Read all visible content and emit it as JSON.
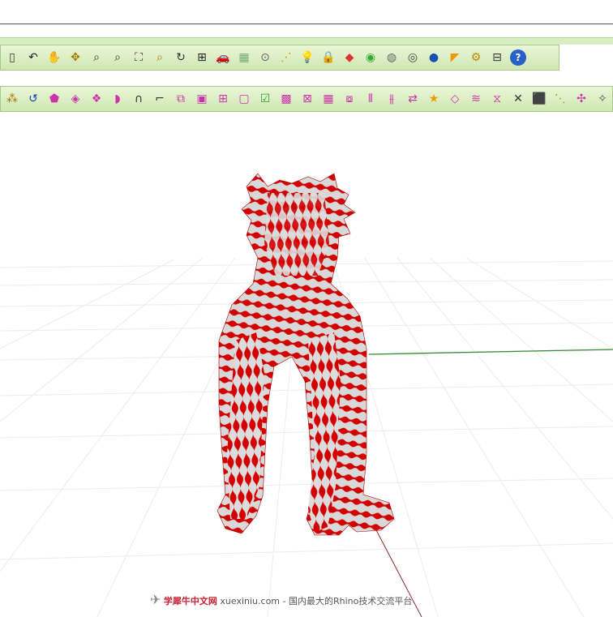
{
  "toolbar_main": {
    "buttons": [
      {
        "name": "new-file-icon",
        "glyph": "▯",
        "color": "#333"
      },
      {
        "name": "undo-icon",
        "glyph": "↶",
        "color": "#222"
      },
      {
        "name": "pan-hand-icon",
        "glyph": "✋",
        "color": "#333"
      },
      {
        "name": "rotate-view-icon",
        "glyph": "✥",
        "color": "#a57a00"
      },
      {
        "name": "zoom-icon",
        "glyph": "⌕",
        "color": "#333"
      },
      {
        "name": "zoom-window-icon",
        "glyph": "⌕",
        "color": "#333"
      },
      {
        "name": "zoom-extents-icon",
        "glyph": "⛶",
        "color": "#333"
      },
      {
        "name": "zoom-selected-icon",
        "glyph": "⌕",
        "color": "#a57a00"
      },
      {
        "name": "undo-view-icon",
        "glyph": "↻",
        "color": "#333"
      },
      {
        "name": "four-viewports-icon",
        "glyph": "⊞",
        "color": "#222"
      },
      {
        "name": "car-icon",
        "glyph": "🚗",
        "color": "#c00"
      },
      {
        "name": "grid-icon",
        "glyph": "▦",
        "color": "#7a7"
      },
      {
        "name": "cplane-icon",
        "glyph": "⊙",
        "color": "#666"
      },
      {
        "name": "select-points-icon",
        "glyph": "⋰",
        "color": "#c90"
      },
      {
        "name": "light-bulb-icon",
        "glyph": "💡",
        "color": "#999"
      },
      {
        "name": "lock-icon",
        "glyph": "🔒",
        "color": "#555"
      },
      {
        "name": "layer-color-icon",
        "glyph": "◆",
        "color": "#d33"
      },
      {
        "name": "color-wheel-icon",
        "glyph": "◉",
        "color": "#3a3"
      },
      {
        "name": "sphere-wire-icon",
        "glyph": "◍",
        "color": "#666"
      },
      {
        "name": "render-sphere-icon",
        "glyph": "◎",
        "color": "#444"
      },
      {
        "name": "blue-sphere-icon",
        "glyph": "●",
        "color": "#1a4fb0"
      },
      {
        "name": "flag-icon",
        "glyph": "◤",
        "color": "#e90"
      },
      {
        "name": "settings-gear-icon",
        "glyph": "⚙",
        "color": "#b80"
      },
      {
        "name": "grouping-icon",
        "glyph": "⊟",
        "color": "#333"
      },
      {
        "name": "help-icon",
        "glyph": "?",
        "color": "#fff",
        "bg": "#2860c8"
      }
    ]
  },
  "toolbar_surface": {
    "buttons": [
      {
        "name": "surface-points-icon",
        "glyph": "⁂",
        "color": "#a70"
      },
      {
        "name": "rebuild-icon",
        "glyph": "↺",
        "color": "#14a"
      },
      {
        "name": "polygon-surface-icon",
        "glyph": "⬟",
        "color": "#c3a"
      },
      {
        "name": "patch-icon",
        "glyph": "◈",
        "color": "#c3a"
      },
      {
        "name": "loft-icon",
        "glyph": "❖",
        "color": "#c3a"
      },
      {
        "name": "sweep-icon",
        "glyph": "◗",
        "color": "#c3a"
      },
      {
        "name": "revolve-icon",
        "glyph": "∩",
        "color": "#333"
      },
      {
        "name": "blend-edge-icon",
        "glyph": "⌐",
        "color": "#333"
      },
      {
        "name": "extrude-icon",
        "glyph": "⧉",
        "color": "#c3a"
      },
      {
        "name": "box-icon",
        "glyph": "▣",
        "color": "#c3a"
      },
      {
        "name": "network-surface-icon",
        "glyph": "⊞",
        "color": "#c3a"
      },
      {
        "name": "frame-icon",
        "glyph": "▢",
        "color": "#c3a"
      },
      {
        "name": "check-surface-icon",
        "glyph": "☑",
        "color": "#393"
      },
      {
        "name": "mesh-icon",
        "glyph": "▩",
        "color": "#c3a"
      },
      {
        "name": "delete-mesh-icon",
        "glyph": "⊠",
        "color": "#c3a"
      },
      {
        "name": "pink-grid-icon",
        "glyph": "▦",
        "color": "#c3a"
      },
      {
        "name": "merge-icon",
        "glyph": "⧇",
        "color": "#c3a"
      },
      {
        "name": "split-icon",
        "glyph": "⫴",
        "color": "#c3a"
      },
      {
        "name": "trim-icon",
        "glyph": "⫵",
        "color": "#c3a"
      },
      {
        "name": "flip-icon",
        "glyph": "⇄",
        "color": "#c3a"
      },
      {
        "name": "star-icon",
        "glyph": "★",
        "color": "#e90"
      },
      {
        "name": "offset-surface-icon",
        "glyph": "◇",
        "color": "#c3a"
      },
      {
        "name": "wave-icon",
        "glyph": "≋",
        "color": "#c3a"
      },
      {
        "name": "warp-icon",
        "glyph": "⧖",
        "color": "#c3a"
      },
      {
        "name": "intersect-icon",
        "glyph": "✕",
        "color": "#333"
      },
      {
        "name": "shaded-block-icon",
        "glyph": "⬛",
        "color": "#333"
      },
      {
        "name": "dots-icon",
        "glyph": "⋱",
        "color": "#c80"
      },
      {
        "name": "nodes-icon",
        "glyph": "✣",
        "color": "#c3a"
      },
      {
        "name": "render-icon",
        "glyph": "✧",
        "color": "#555"
      }
    ]
  },
  "watermark": {
    "brand": "学犀牛中文网",
    "url": " xuexiniu.com ",
    "tagline": " - 国内最大的Rhino技术交流平台"
  }
}
